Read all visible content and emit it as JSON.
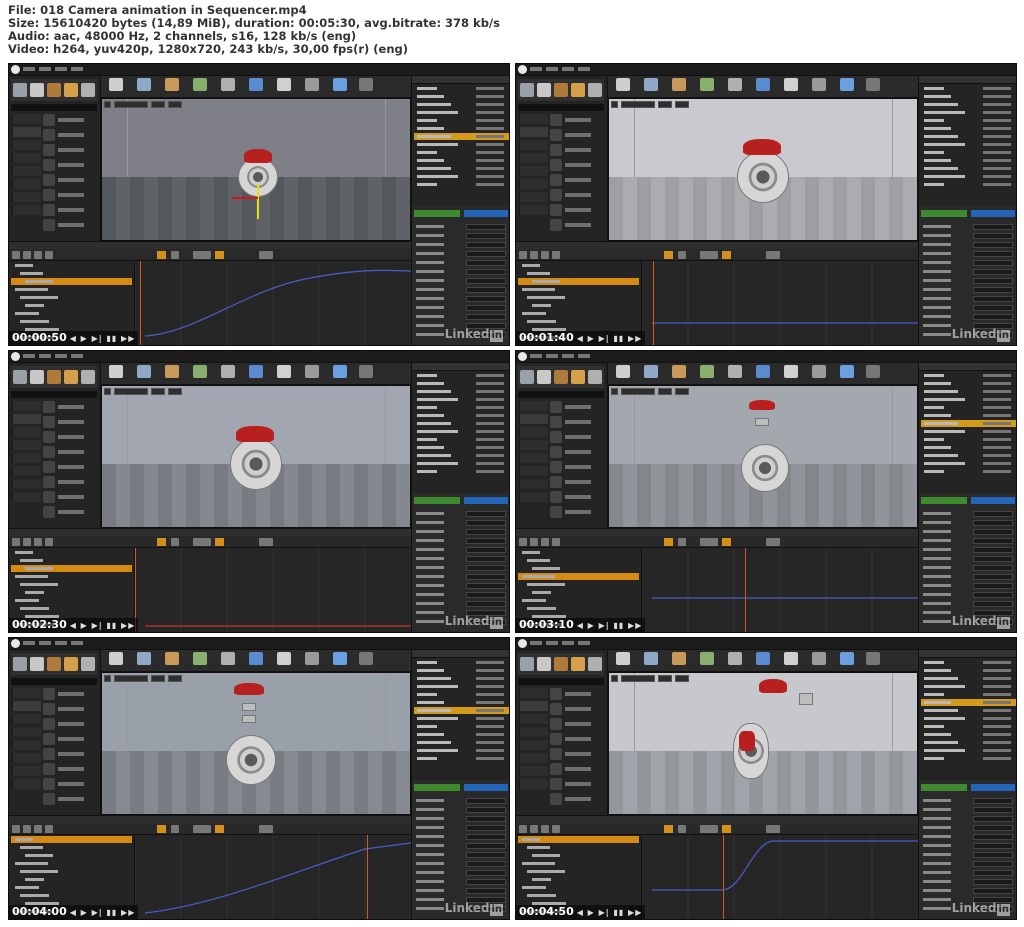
{
  "header": {
    "line1": "File: 018 Camera animation in Sequencer.mp4",
    "line2": "Size: 15610420 bytes (14,89 MiB), duration: 00:05:30, avg.bitrate: 378 kb/s",
    "line3": "Audio: aac, 48000 Hz, 2 channels, s16, 128 kb/s (eng)",
    "line4": "Video: h264, yuv420p, 1280x720, 243 kb/s, 30,00 fps(r) (eng)"
  },
  "colors": {
    "sequencer_orange": "#d48a13",
    "caliper_red": "#b81f1f",
    "add_component_green": "#3f8a2e",
    "blueprint_blue": "#2465b8"
  },
  "icons": {
    "playback_controls": "◀ ▶ ▶▶ ⏭ ⏮",
    "watermark_logo": "LinkedIn"
  },
  "watermark": {
    "prefix": "Linked",
    "suffix": "in"
  },
  "controls_glyphs": "◀ ▶ ▶| ▮▮ ▶▶",
  "thumbnails": [
    {
      "timestamp": "00:00:50"
    },
    {
      "timestamp": "00:01:40"
    },
    {
      "timestamp": "00:02:30"
    },
    {
      "timestamp": "00:03:10"
    },
    {
      "timestamp": "00:04:00"
    },
    {
      "timestamp": "00:04:50"
    }
  ]
}
